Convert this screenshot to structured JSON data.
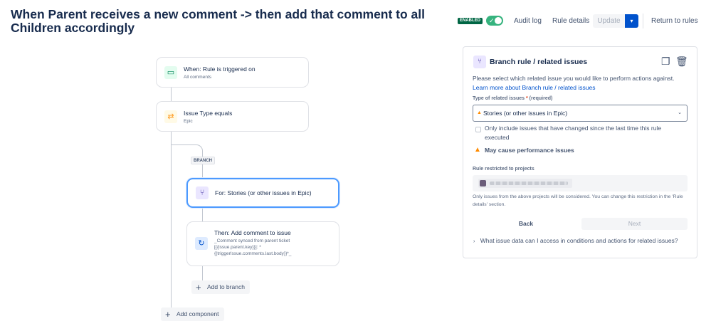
{
  "header": {
    "title": "When Parent receives a new comment -> then add that comment to all Children accordingly",
    "enabled_badge": "ENABLED",
    "toggle_check": "✓",
    "audit_log": "Audit log",
    "rule_details": "Rule details",
    "update": "Update",
    "update_dropdown": "▾",
    "return": "Return to rules"
  },
  "flow": {
    "trigger": {
      "title": "When: Rule is triggered on",
      "subtitle": "All comments",
      "icon": "comment-icon"
    },
    "condition": {
      "title": "Issue Type equals",
      "subtitle": "Epic",
      "icon": "shuffle-icon"
    },
    "branch_label": "BRANCH",
    "branch": {
      "title": "For: Stories (or other issues in Epic)",
      "icon": "branch-icon"
    },
    "action": {
      "title": "Then: Add comment to issue",
      "lines": [
        "_Comment synced from parent ticket",
        "[{{issue.parent.key}}]: *",
        "{{triggerIssue.comments.last.body}}*_"
      ],
      "icon": "refresh-icon"
    },
    "add_to_branch": "Add to branch",
    "add_component": "Add component",
    "plus": "+"
  },
  "panel": {
    "title": "Branch rule / related issues",
    "description": "Please select which related issue you would like to perform actions against.",
    "link": "Learn more about Branch rule / related issues",
    "type_label": "Type of related issues",
    "type_label_star": "*",
    "type_label_required": "(required)",
    "select_value": "Stories (or other issues in Epic)",
    "select_warn": "▲",
    "select_chevron": "⌄",
    "checkbox_label": "Only include issues that have changed since the last time this rule executed",
    "warning_icon": "▲",
    "warning": "May cause performance issues",
    "restricted_label": "Rule restricted to projects",
    "note": "Only issues from the above projects will be considered. You can change this restriction in the 'Rule details' section.",
    "back": "Back",
    "next": "Next",
    "faq_arrow": "›",
    "faq": "What issue data can I access in conditions and actions for related issues?"
  },
  "colors": {
    "primary": "#0052cc",
    "enabled": "#36b37e",
    "warning": "#ff8b00",
    "text": "#172b4d"
  }
}
